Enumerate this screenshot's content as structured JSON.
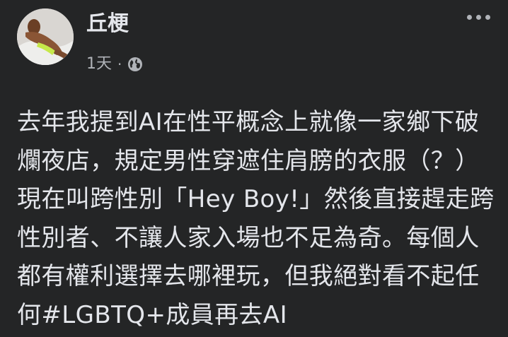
{
  "post": {
    "author": "丘梗",
    "time": "1天",
    "separator": "·",
    "privacy_icon": "globe-icon",
    "more_icon": "more-horizontal-icon",
    "lines": [
      "去年我提到AI在性平概念上就像一家鄉下破",
      "爛夜店，規定男性穿遮住肩膀的衣服（？）",
      "現在叫跨性別「Hey Boy!」然後直接趕走跨",
      "性別者、不讓人家入場也不足為奇。每個人",
      "都有權利選擇去哪裡玩，但我絕對看不起任"
    ],
    "last_line_prefix": "何",
    "hashtag": "#LGBTQ+",
    "last_line_suffix": "成員再去AI"
  },
  "colors": {
    "background": "#242526",
    "primary_text": "#e4e6eb",
    "secondary_text": "#b0b3b8"
  }
}
